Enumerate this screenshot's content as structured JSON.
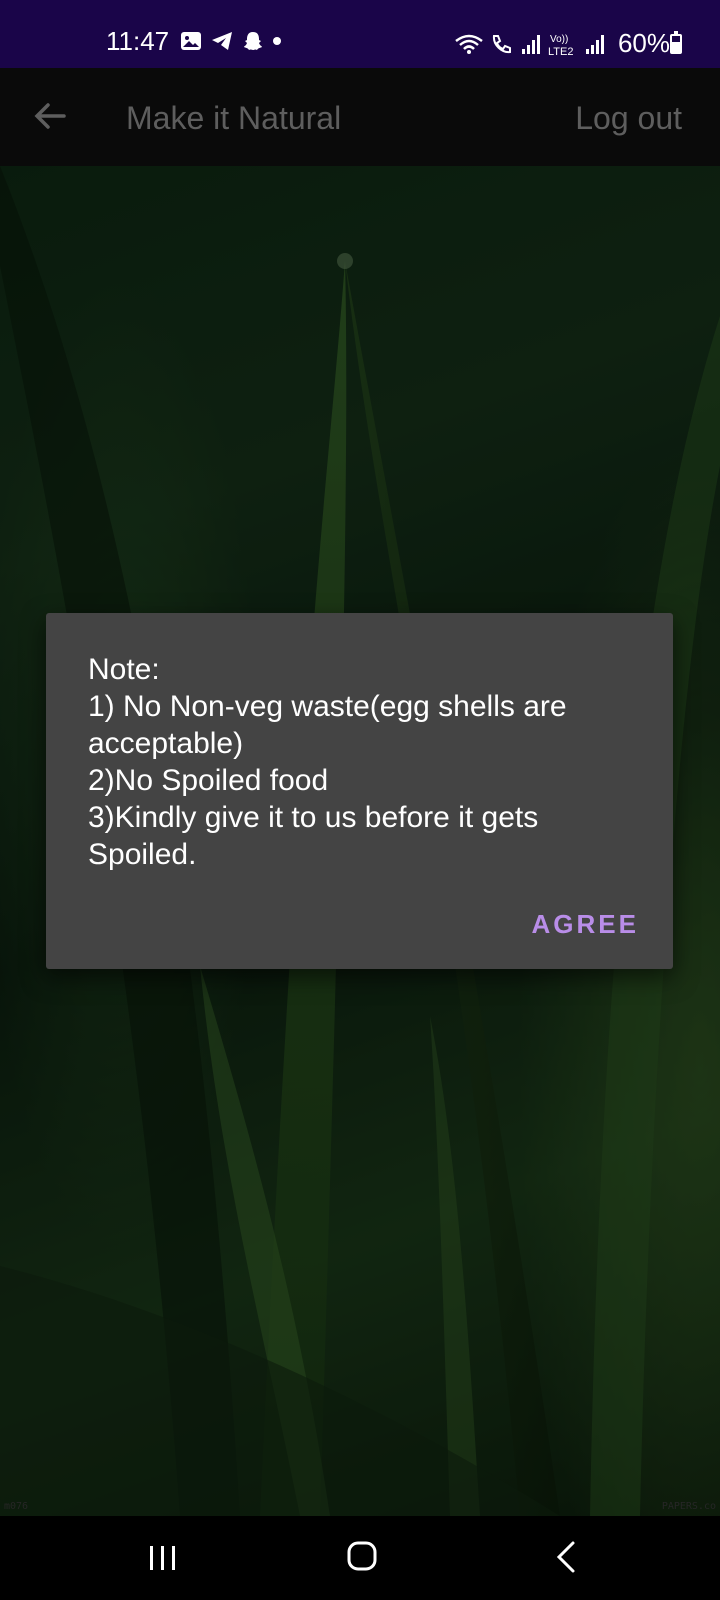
{
  "status_bar": {
    "time": "11:47",
    "battery": "60%",
    "battery_level": 0.6,
    "left_icons": [
      "gallery-icon",
      "telegram-icon",
      "snapchat-icon",
      "dot-icon"
    ],
    "right_icons": [
      "wifi-icon",
      "call-icon",
      "signal-icon",
      "volte-icon",
      "signal-icon"
    ],
    "volte_label": "Vo)) LTE2"
  },
  "app_bar": {
    "title": "Make it Natural",
    "logout_label": "Log out",
    "back_icon": "arrow-left-icon"
  },
  "dialog": {
    "message": "Note:\n1) No Non-veg waste(egg shells are acceptable)\n2)No Spoiled food\n3)Kindly give it to us before it gets Spoiled.",
    "agree_label": "AGREE",
    "accent_color": "#b98de8"
  },
  "background": {
    "watermark_left": "m076",
    "watermark_right": "PAPERS.co"
  },
  "nav_bar": {
    "icons": [
      "recents-icon",
      "home-icon",
      "back-icon"
    ]
  }
}
